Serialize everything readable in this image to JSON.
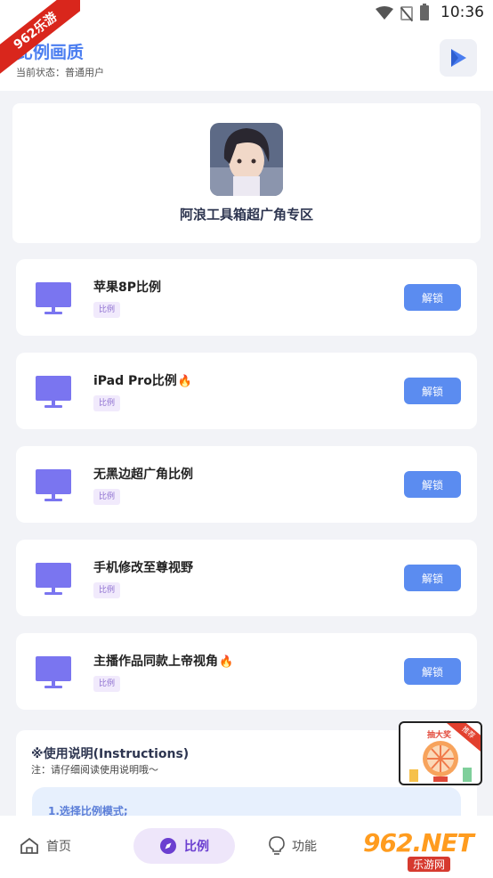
{
  "status_bar": {
    "time": "10:36"
  },
  "watermark": {
    "ribbon": "962乐游",
    "site_big": "962.NET",
    "site_small": "乐游网"
  },
  "header": {
    "title": "比例画质",
    "subtitle": "当前状态：普通用户"
  },
  "profile": {
    "name": "阿浪工具箱超广角专区"
  },
  "items": [
    {
      "name": "苹果8P比例",
      "tag": "比例",
      "button": "解锁",
      "hot": false
    },
    {
      "name": "iPad Pro比例",
      "tag": "比例",
      "button": "解锁",
      "hot": true
    },
    {
      "name": "无黑边超广角比例",
      "tag": "比例",
      "button": "解锁",
      "hot": false
    },
    {
      "name": "手机修改至尊视野",
      "tag": "比例",
      "button": "解锁",
      "hot": false
    },
    {
      "name": "主播作品同款上帝视角",
      "tag": "比例",
      "button": "解锁",
      "hot": true
    }
  ],
  "instructions": {
    "heading": "※使用说明(Instructions)",
    "note": "注：请仔细阅读使用说明哦～",
    "step1": "1.选择比例模式;"
  },
  "promo": {
    "title": "抽大奖",
    "corner": "推荐"
  },
  "nav": {
    "home": "首页",
    "ratio": "比例",
    "function": "功能"
  },
  "colors": {
    "accent": "#4a7df0",
    "button": "#5b8cf0",
    "monitor": "#7a75f0",
    "tag_text": "#8d6fd0"
  }
}
